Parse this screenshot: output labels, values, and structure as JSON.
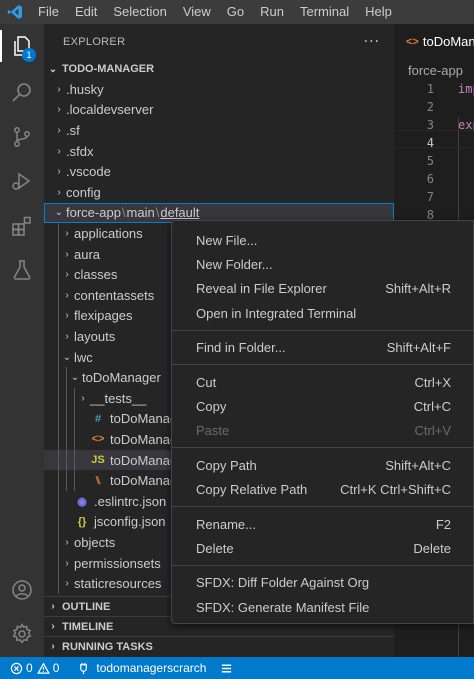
{
  "menubar": {
    "items": [
      "File",
      "Edit",
      "Selection",
      "View",
      "Go",
      "Run",
      "Terminal",
      "Help"
    ]
  },
  "activity": {
    "explorer_badge": "1",
    "icons": [
      "files-icon",
      "search-icon",
      "source-control-icon",
      "run-debug-icon",
      "extensions-icon",
      "testing-icon",
      "account-icon",
      "settings-gear-icon"
    ]
  },
  "sidebar": {
    "title": "EXPLORER",
    "more": "···",
    "workspace": "TODO-MANAGER",
    "tree": [
      {
        "label": ".husky",
        "depth": 1,
        "type": "folder",
        "expanded": false
      },
      {
        "label": ".localdevserver",
        "depth": 1,
        "type": "folder",
        "expanded": false
      },
      {
        "label": ".sf",
        "depth": 1,
        "type": "folder",
        "expanded": false
      },
      {
        "label": ".sfdx",
        "depth": 1,
        "type": "folder",
        "expanded": false
      },
      {
        "label": ".vscode",
        "depth": 1,
        "type": "folder",
        "expanded": false
      },
      {
        "label": "config",
        "depth": 1,
        "type": "folder",
        "expanded": false
      },
      {
        "label": "force-app",
        "depth": 1,
        "type": "folder",
        "expanded": true,
        "compact": [
          "force-app",
          "main",
          "default"
        ]
      },
      {
        "label": "applications",
        "depth": 2,
        "type": "folder",
        "expanded": false
      },
      {
        "label": "aura",
        "depth": 2,
        "type": "folder",
        "expanded": false
      },
      {
        "label": "classes",
        "depth": 2,
        "type": "folder",
        "expanded": false
      },
      {
        "label": "contentassets",
        "depth": 2,
        "type": "folder",
        "expanded": false
      },
      {
        "label": "flexipages",
        "depth": 2,
        "type": "folder",
        "expanded": false
      },
      {
        "label": "layouts",
        "depth": 2,
        "type": "folder",
        "expanded": false
      },
      {
        "label": "lwc",
        "depth": 2,
        "type": "folder",
        "expanded": true
      },
      {
        "label": "toDoManager",
        "depth": 3,
        "type": "folder",
        "expanded": true
      },
      {
        "label": "__tests__",
        "depth": 4,
        "type": "folder",
        "expanded": false
      },
      {
        "label": "toDoManager.css",
        "depth": 4,
        "type": "file",
        "icon": "#",
        "icon_color": "#519aba"
      },
      {
        "label": "toDoManager.html",
        "depth": 4,
        "type": "file",
        "icon": "<>",
        "icon_color": "#e37933"
      },
      {
        "label": "toDoManager.js",
        "depth": 4,
        "type": "file",
        "icon": "JS",
        "icon_color": "#cbcb41"
      },
      {
        "label": "toDoManager.js-meta.xml",
        "depth": 4,
        "type": "file",
        "icon": "⑊",
        "icon_color": "#e37933"
      },
      {
        "label": ".eslintrc.json",
        "depth": 2,
        "type": "file",
        "icon": "◉",
        "icon_color": "#8080f2"
      },
      {
        "label": "jsconfig.json",
        "depth": 2,
        "type": "file",
        "icon": "{}",
        "icon_color": "#cbcb41"
      },
      {
        "label": "objects",
        "depth": 2,
        "type": "folder",
        "expanded": false
      },
      {
        "label": "permissionsets",
        "depth": 2,
        "type": "folder",
        "expanded": false
      },
      {
        "label": "staticresources",
        "depth": 2,
        "type": "folder",
        "expanded": false
      }
    ],
    "sections": [
      "OUTLINE",
      "TIMELINE",
      "RUNNING TASKS"
    ]
  },
  "editor": {
    "tab_label": "toDoMana",
    "breadcrumb": "force-app",
    "line_numbers": [
      "1",
      "2",
      "3",
      "4",
      "5",
      "6",
      "7",
      "8"
    ],
    "current_line": "4",
    "code": [
      {
        "line": "1",
        "text": "imp"
      },
      {
        "line": "3",
        "text": "exp"
      }
    ]
  },
  "context_menu": {
    "groups": [
      [
        {
          "label": "New File...",
          "shortcut": ""
        },
        {
          "label": "New Folder...",
          "shortcut": ""
        },
        {
          "label": "Reveal in File Explorer",
          "shortcut": "Shift+Alt+R"
        },
        {
          "label": "Open in Integrated Terminal",
          "shortcut": ""
        }
      ],
      [
        {
          "label": "Find in Folder...",
          "shortcut": "Shift+Alt+F"
        }
      ],
      [
        {
          "label": "Cut",
          "shortcut": "Ctrl+X"
        },
        {
          "label": "Copy",
          "shortcut": "Ctrl+C"
        },
        {
          "label": "Paste",
          "shortcut": "Ctrl+V",
          "disabled": true
        }
      ],
      [
        {
          "label": "Copy Path",
          "shortcut": "Shift+Alt+C"
        },
        {
          "label": "Copy Relative Path",
          "shortcut": "Ctrl+K Ctrl+Shift+C"
        }
      ],
      [
        {
          "label": "Rename...",
          "shortcut": "F2"
        },
        {
          "label": "Delete",
          "shortcut": "Delete"
        }
      ],
      [
        {
          "label": "SFDX: Diff Folder Against Org",
          "shortcut": ""
        },
        {
          "label": "SFDX: Generate Manifest File",
          "shortcut": ""
        }
      ]
    ]
  },
  "statusbar": {
    "errors": "0",
    "warnings": "0",
    "org": "todomanagerscrarch"
  },
  "colors": {
    "accent": "#007acc",
    "selection_border": "#007fd4"
  }
}
